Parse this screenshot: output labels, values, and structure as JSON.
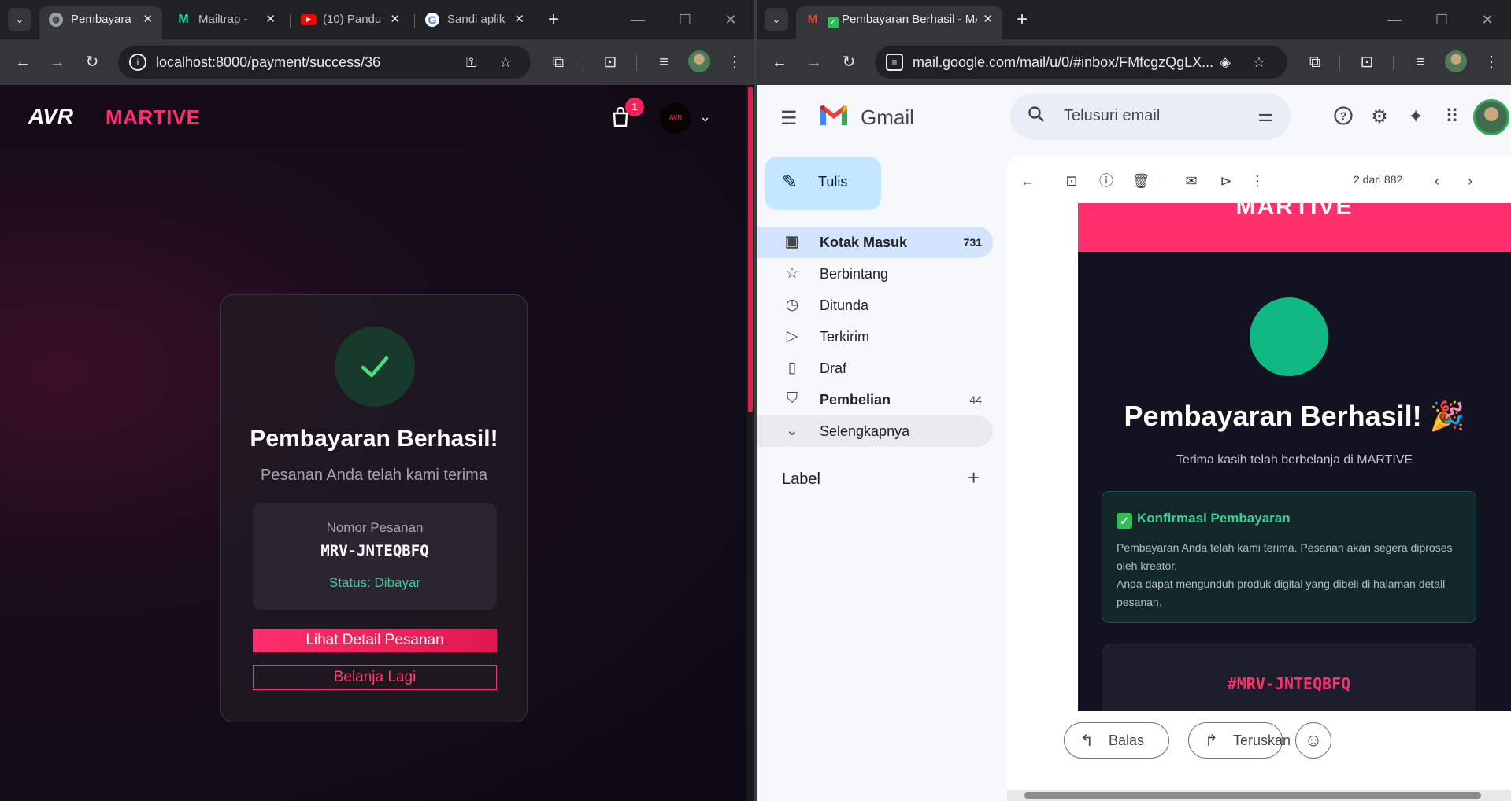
{
  "left_window": {
    "tabs": [
      {
        "label": "Pembayaran",
        "favicon": "globe-icon",
        "active": true
      },
      {
        "label": "Mailtrap -",
        "favicon": "mailtrap-icon",
        "active": false
      },
      {
        "label": "(10) Pandu",
        "favicon": "youtube-icon",
        "active": false
      },
      {
        "label": "Sandi aplik",
        "favicon": "google-icon",
        "active": false
      }
    ],
    "url": "localhost:8000/payment/success/36"
  },
  "martive": {
    "logo_text": "AVR",
    "brand": "MARTIVE",
    "cart_count": "1",
    "avatar_text": "AVR",
    "title": "Pembayaran Berhasil!",
    "subtitle": "Pesanan Anda telah kami terima",
    "order_label": "Nomor Pesanan",
    "order_number": "MRV-JNTEQBFQ",
    "status": "Status: Dibayar",
    "primary_button": "Lihat Detail Pesanan",
    "secondary_button": "Belanja Lagi",
    "colors": {
      "accent": "#ff2e6c",
      "success": "#34d399"
    }
  },
  "right_window": {
    "tab": {
      "label": "Pembayaran Berhasil - MAR",
      "favicon": "gmail-icon"
    },
    "url": "mail.google.com/mail/u/0/#inbox/FMfcgzQgLX..."
  },
  "gmail": {
    "app_name": "Gmail",
    "search_placeholder": "Telusuri email",
    "compose": "Tulis",
    "nav": [
      {
        "label": "Kotak Masuk",
        "count": "731",
        "icon": "inbox-icon"
      },
      {
        "label": "Berbintang",
        "count": "",
        "icon": "star-icon"
      },
      {
        "label": "Ditunda",
        "count": "",
        "icon": "clock-icon"
      },
      {
        "label": "Terkirim",
        "count": "",
        "icon": "send-icon"
      },
      {
        "label": "Draf",
        "count": "",
        "icon": "draft-icon"
      },
      {
        "label": "Pembelian",
        "count": "44",
        "icon": "bag-icon"
      },
      {
        "label": "Selengkapnya",
        "count": "",
        "icon": "chevron-down-icon"
      }
    ],
    "labels_heading": "Label",
    "pagination": "2 dari 882",
    "email": {
      "header_brand": "MARTIVE",
      "title": "Pembayaran Berhasil! 🎉",
      "subtitle": "Terima kasih telah berbelanja di MARTIVE",
      "confirm_title": "Konfirmasi Pembayaran",
      "confirm_line1": "Pembayaran Anda telah kami terima. Pesanan akan segera diproses oleh kreator.",
      "confirm_line2": "Anda dapat mengunduh produk digital yang dibeli di halaman detail pesanan.",
      "order_code": "#MRV-JNTEQBFQ"
    },
    "reply_label": "Balas",
    "forward_label": "Teruskan"
  }
}
